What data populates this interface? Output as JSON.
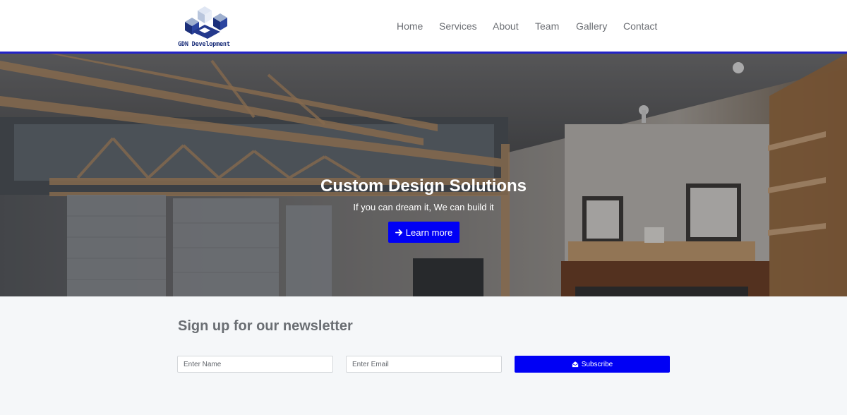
{
  "brand": {
    "name": "GDN Development",
    "logo_icon": "isometric-cubes-logo"
  },
  "nav": {
    "items": [
      {
        "label": "Home"
      },
      {
        "label": "Services"
      },
      {
        "label": "About"
      },
      {
        "label": "Team"
      },
      {
        "label": "Gallery"
      },
      {
        "label": "Contact"
      }
    ]
  },
  "hero": {
    "title": "Custom Design Solutions",
    "subtitle": "If you can dream it, We can build it",
    "cta_label": "Learn more",
    "cta_icon": "arrow-right-icon"
  },
  "newsletter": {
    "title": "Sign up for our newsletter",
    "name_placeholder": "Enter Name",
    "email_placeholder": "Enter Email",
    "subscribe_label": "Subscribe",
    "subscribe_icon": "envelope-open-icon"
  },
  "colors": {
    "accent": "#0000f5",
    "header_border": "#2323c8",
    "nav_text": "#6c6f74",
    "page_bg": "#f5f7f9"
  }
}
